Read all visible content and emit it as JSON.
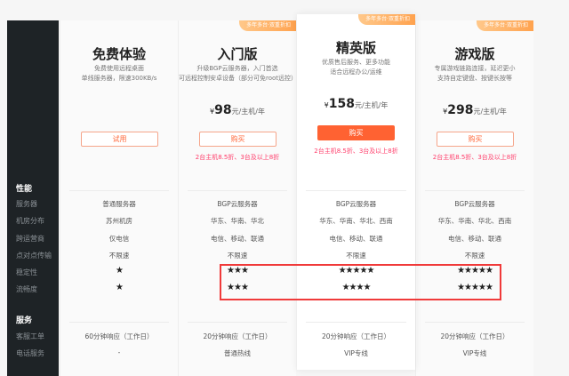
{
  "sidebar": {
    "performance": {
      "heading": "性能",
      "items": [
        "服务器",
        "机房分布",
        "跨运营商",
        "点对点传输",
        "稳定性",
        "流畅度"
      ]
    },
    "service": {
      "heading": "服务",
      "items": [
        "客服工单",
        "电话服务"
      ]
    }
  },
  "plans": [
    {
      "title": "免费体验",
      "desc": [
        "免费使用远程桌面",
        "单线服务器，限速300KB/s"
      ],
      "button": "试用",
      "perf": [
        "普通服务器",
        "苏州机房",
        "仅电信",
        "不限速",
        "★",
        "★"
      ],
      "service": [
        "60分钟响应（工作日）",
        "-"
      ]
    },
    {
      "badge": "多年多台·双重折扣",
      "title": "入门版",
      "desc": [
        "升级BGP云服务器，入门首选",
        "可远程控制安卓设备（部分可免root远控）"
      ],
      "currency": "¥",
      "price": "98",
      "unit": "元/主机/年",
      "button": "购买",
      "promo": "2台主机8.5折、3台及以上8折",
      "perf": [
        "BGP云服务器",
        "华东、华南、华北",
        "电信、移动、联通",
        "不限速",
        "★★★",
        "★★★"
      ],
      "service": [
        "20分钟响应（工作日）",
        "普通热线"
      ]
    },
    {
      "badge": "多年多台·双重折扣",
      "title": "精英版",
      "desc": [
        "优质售后服务、更多功能",
        "适合远程办公/运维"
      ],
      "currency": "¥",
      "price": "158",
      "unit": "元/主机/年",
      "button": "购买",
      "promo": "2台主机8.5折、3台及以上8折",
      "perf": [
        "BGP云服务器",
        "华东、华南、华北、西南",
        "电信、移动、联通",
        "不限速",
        "★★★★★",
        "★★★★"
      ],
      "service": [
        "20分钟响应（工作日）",
        "VIP专线"
      ]
    },
    {
      "badge": "多年多台·双重折扣",
      "title": "游戏版",
      "desc": [
        "专属游戏链路连接，延迟更小",
        "支持自定键盘、按键长按等"
      ],
      "currency": "¥",
      "price": "298",
      "unit": "元/主机/年",
      "button": "购买",
      "promo": "2台主机8.5折、3台及以上8折",
      "perf": [
        "BGP云服务器",
        "华东、华南、华北、西南",
        "电信、移动、联通",
        "不限速",
        "★★★★★",
        "★★★★★"
      ],
      "service": [
        "20分钟响应（工作日）",
        "VIP专线"
      ]
    }
  ],
  "colors": {
    "accent": "#ff6232",
    "promo": "#ff3d6a",
    "sidebar": "#1e2326",
    "highlight_box": "#f03a3a"
  }
}
